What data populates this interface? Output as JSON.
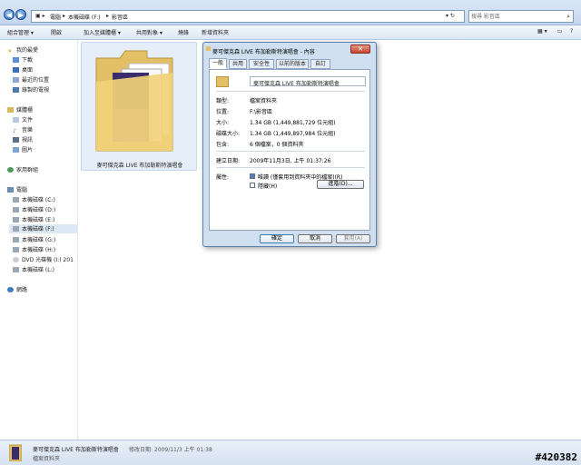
{
  "address": {
    "segments": [
      "電腦",
      "本機磁碟 (F:)",
      "影音區"
    ],
    "search_placeholder": "搜尋 影音區"
  },
  "toolbar": {
    "organize": "組合管理 ▾",
    "open": "開啟",
    "include_library": "加入至媒體櫃 ▾",
    "share": "共用對象 ▾",
    "burn": "燒錄",
    "new_folder": "新增資料夾"
  },
  "sidebar": {
    "favorites": "我的最愛",
    "fav_items": [
      "下載",
      "桌面",
      "最近的位置",
      "錄製的電視"
    ],
    "libraries": "媒體櫃",
    "lib_items": [
      "文件",
      "音樂",
      "視訊",
      "圖片"
    ],
    "homegroup": "家用群組",
    "computer": "電腦",
    "drives": [
      "本機磁碟 (C:)",
      "本機磁碟 (D:)",
      "本機磁碟 (E:)",
      "本機磁碟 (F:)",
      "本機磁碟 (G:)",
      "本機磁碟 (H:)",
      "DVD 光碟機 (I:) 201",
      "本機磁碟 (L:)"
    ],
    "network": "網路"
  },
  "folder": {
    "caption": "麥可傑克森 LIVE 布加勒斯特演唱會"
  },
  "dialog": {
    "title": "麥可傑克森 LIVE 布加勒斯特演唱會 - 內容",
    "tabs": [
      "一般",
      "共用",
      "安全性",
      "以前的版本",
      "自訂"
    ],
    "name_value": "麥可傑克森 LIVE 布加勒斯特演唱會",
    "type_label": "類型:",
    "type_value": "檔案資料夾",
    "location_label": "位置:",
    "location_value": "F:\\影音區",
    "size_label": "大小:",
    "size_value": "1.34 GB (1,449,881,729 位元組)",
    "disk_label": "磁碟大小:",
    "disk_value": "1.34 GB (1,449,897,984 位元組)",
    "contains_label": "包含:",
    "contains_value": "6 個檔案，0 個資料夾",
    "created_label": "建立日期:",
    "created_value": "2009年11月3日, 上午 01:37:26",
    "attr_label": "屬性:",
    "readonly_label": "唯讀 (僅套用到資料夾中的檔案)(R)",
    "hidden_label": "隱藏(H)",
    "advanced_button": "進階(D)...",
    "ok_button": "確定",
    "cancel_button": "取消",
    "apply_button": "套用(A)"
  },
  "statusbar": {
    "name": "麥可傑克森 LIVE 布加勒斯特演唱會",
    "modified": "修改日期: 2009/11/3 上午 01:38",
    "type": "檔案資料夾"
  },
  "watermark": "#420382",
  "colors": {
    "accent": "#2b68b4",
    "folder": "#f2d27a",
    "close": "#c4452e"
  }
}
